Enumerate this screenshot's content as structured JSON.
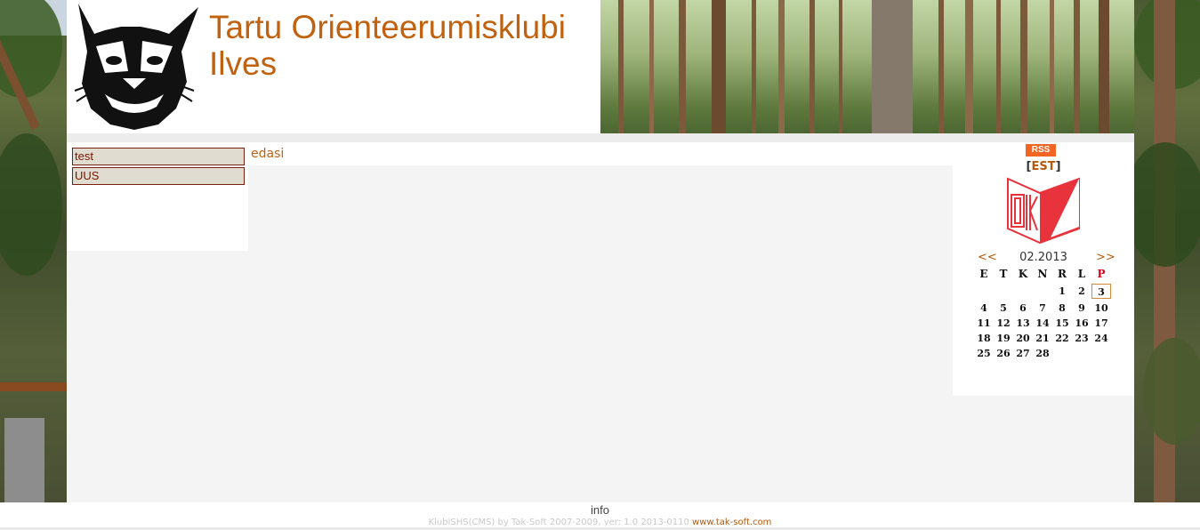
{
  "header": {
    "title_line1": "Tartu Orienteerumisklubi",
    "title_line2": "Ilves"
  },
  "menu": {
    "items": [
      {
        "label": "test"
      },
      {
        "label": "UUS"
      }
    ]
  },
  "main": {
    "link_label": "edasi"
  },
  "sidebar": {
    "rss_label": "RSS",
    "lang_open": "[",
    "lang_label": "EST",
    "lang_close": "]"
  },
  "calendar": {
    "prev_label": "<<",
    "next_label": ">>",
    "month_label": "02.2013",
    "weekdays": [
      "E",
      "T",
      "K",
      "N",
      "R",
      "L",
      "P"
    ],
    "weeks": [
      [
        "",
        "",
        "",
        "",
        "1",
        "2",
        "3"
      ],
      [
        "4",
        "5",
        "6",
        "7",
        "8",
        "9",
        "10"
      ],
      [
        "11",
        "12",
        "13",
        "14",
        "15",
        "16",
        "17"
      ],
      [
        "18",
        "19",
        "20",
        "21",
        "22",
        "23",
        "24"
      ],
      [
        "25",
        "26",
        "27",
        "28",
        "",
        "",
        ""
      ]
    ],
    "today": "3",
    "sunday_color": "#d8001a"
  },
  "footer": {
    "info_label": "info",
    "credit_text": "KlubiSHS(CMS) by Tak-Soft 2007-2009, ver: 1.0 2013-0110",
    "credit_link": "www.tak-soft.com"
  },
  "colors": {
    "accent": "#c0620f",
    "menu_border": "#7a1e10"
  }
}
